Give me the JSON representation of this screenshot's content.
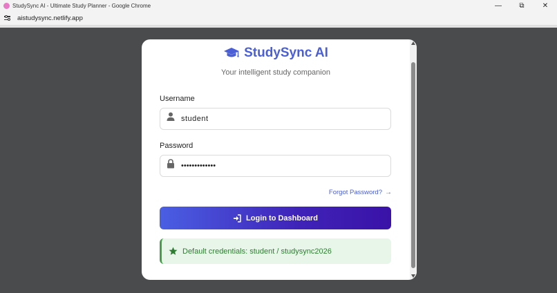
{
  "window": {
    "title": "StudySync AI - Ultimate Study Planner - Google Chrome",
    "minimize_glyph": "—",
    "restore_glyph": "⧉",
    "close_glyph": "✕"
  },
  "browser": {
    "url": "aistudysync.netlify.app"
  },
  "login": {
    "brand": "StudySync AI",
    "brand_icon": "graduation-cap-icon",
    "subtitle": "Your intelligent study companion",
    "username_label": "Username",
    "username_value": "student",
    "password_label": "Password",
    "password_value": "•••••••••••••",
    "forgot_label": "Forgot Password?",
    "forgot_arrow": "→",
    "login_button_label": "Login to Dashboard",
    "hint": "Default credentials: student / studysync2026"
  },
  "colors": {
    "brand": "#4a5fd6",
    "button_start": "#4a5fe3",
    "button_end": "#3a12a8",
    "hint_bg": "#e8f5e9",
    "hint_text": "#2e7d32",
    "backdrop": "#4a4b4d"
  }
}
